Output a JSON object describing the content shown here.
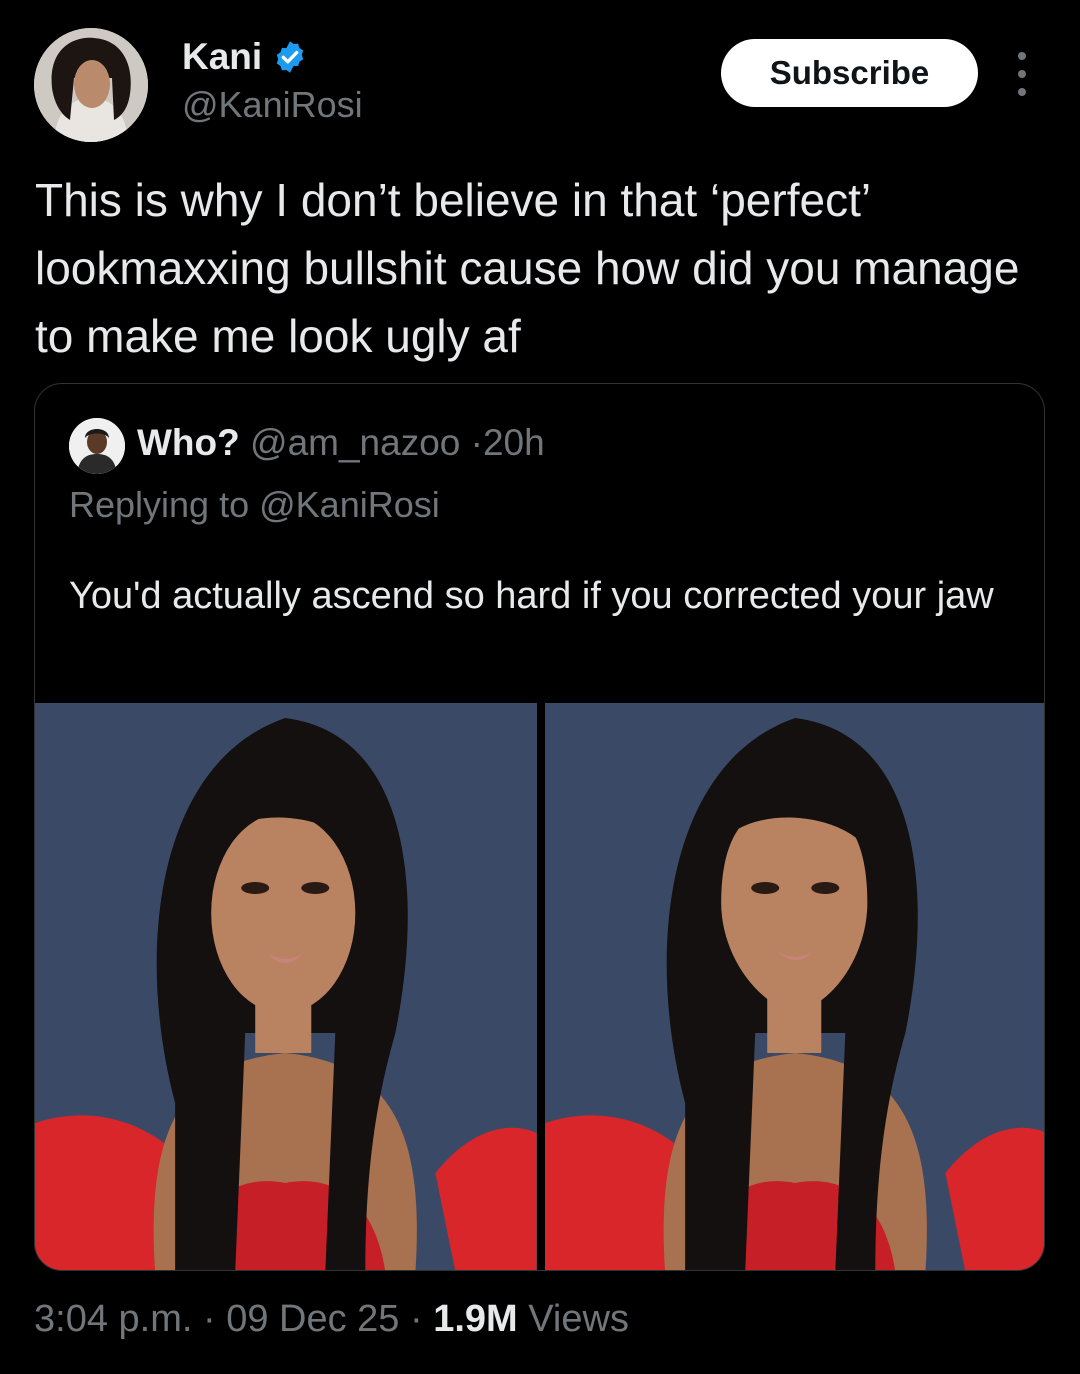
{
  "author": {
    "name": "Kani",
    "handle": "@KaniRosi",
    "verified": true,
    "verified_color": "#1d9bf0"
  },
  "actions": {
    "subscribe_label": "Subscribe",
    "more_icon": "more-vertical-icon"
  },
  "tweet": {
    "text": "This is why I don’t believe in that ‘perfect’ lookmaxxing bullshit cause how did you manage to make me look ugly af"
  },
  "quoted_tweet": {
    "name": "Who?",
    "handle": "@am_nazoo",
    "separator": "·",
    "time": "20h",
    "replying_prefix": "Replying to",
    "replying_to": "@KaniRosi",
    "text": "You'd actually ascend so hard if you corrected your jaw",
    "media": [
      "photo-original",
      "photo-edited"
    ]
  },
  "meta": {
    "time": "3:04 p.m.",
    "sep1": "·",
    "date": "09 Dec 25",
    "sep2": "·",
    "views_count": "1.9M",
    "views_label": "Views"
  },
  "colors": {
    "background": "#000000",
    "text_primary": "#e7e9ea",
    "text_secondary": "#71767b",
    "border": "#2f3336",
    "photo_backdrop": "#3a4a66",
    "dress_red": "#d9262b"
  }
}
